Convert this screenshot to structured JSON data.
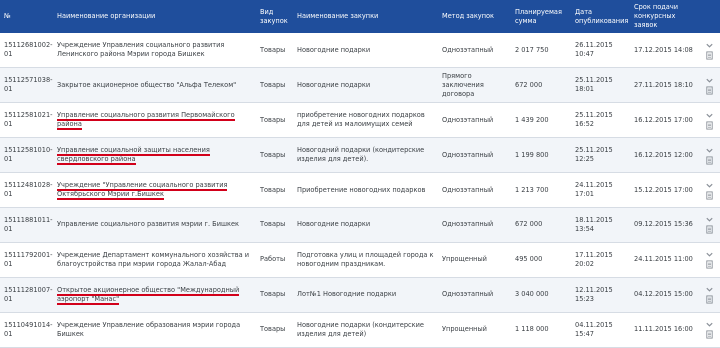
{
  "headers": {
    "num": "№",
    "org": "Наименование организации",
    "type": "Вид закупок",
    "name": "Наименование закупки",
    "method": "Метод закупок",
    "sum": "Планируемая сумма",
    "pub": "Дата опубликования",
    "deadline": "Срок подачи конкурсных заявок"
  },
  "rows": [
    {
      "num": "15112681002-01",
      "org": "Учреждение Управления социального развития Ленинского района Мэрии города Бишкек",
      "type": "Товары",
      "name": "Новогодние подарки",
      "method": "Однозэтапный",
      "sum": "2 017 750",
      "pub": "26.11.2015 10:47",
      "deadline": "17.12.2015 14:08",
      "hl": false
    },
    {
      "num": "15112571038-01",
      "org": "Закрытое акционерное общество \"Альфа Телеком\"",
      "type": "Товары",
      "name": "Новогодние подарки",
      "method": "Прямого заключения договора",
      "sum": "672 000",
      "pub": "25.11.2015 18:01",
      "deadline": "27.11.2015 18:10",
      "hl": false
    },
    {
      "num": "15112581021-01",
      "org": "Управление социального развития Первомайского района",
      "type": "Товары",
      "name": "приобретение новогодних подарков для детей из малоимущих семей",
      "method": "Однозэтапный",
      "sum": "1 439 200",
      "pub": "25.11.2015 16:52",
      "deadline": "16.12.2015 17:00",
      "hl": true
    },
    {
      "num": "15112581010-01",
      "org": "Управление социальной защиты населения свердловского района",
      "type": "Товары",
      "name": "Новогодний подарки (кондитерские изделия для детей).",
      "method": "Однозэтапный",
      "sum": "1 199 800",
      "pub": "25.11.2015 12:25",
      "deadline": "16.12.2015 12:00",
      "hl": true
    },
    {
      "num": "15112481028-01",
      "org": "Учреждение \"Управление социального развития Октябрьского Мэрии г.Бишкек",
      "type": "Товары",
      "name": "Приобретение новогодних подарков",
      "method": "Однозэтапный",
      "sum": "1 213 700",
      "pub": "24.11.2015 17:01",
      "deadline": "15.12.2015 17:00",
      "hl": true
    },
    {
      "num": "15111881011-01",
      "org": "Управление социального развития мэрии г. Бишкек",
      "type": "Товары",
      "name": "Новогодние подарки",
      "method": "Однозэтапный",
      "sum": "672 000",
      "pub": "18.11.2015 13:54",
      "deadline": "09.12.2015 15:36",
      "hl": false
    },
    {
      "num": "15111792001-01",
      "org": "Учреждение Департамент коммунального хозяйства и благоустройства при мэрии города Жалал-Абад",
      "type": "Работы",
      "name": "Подготовка улиц и площадей города к новогодним праздникам.",
      "method": "Упрощенный",
      "sum": "495 000",
      "pub": "17.11.2015 20:02",
      "deadline": "24.11.2015 11:00",
      "hl": false
    },
    {
      "num": "15111281007-01",
      "org": "Открытое акционерное общество \"Международный аэропорт \"Манас\"",
      "type": "Товары",
      "name": "Лот№1 Новогодние подарки",
      "method": "Однозэтапный",
      "sum": "3 040 000",
      "pub": "12.11.2015 15:23",
      "deadline": "04.12.2015 15:00",
      "hl": true
    },
    {
      "num": "15110491014-01",
      "org": "Учреждение Управление образования мэрии города Бишкек",
      "type": "Товары",
      "name": "Новогодние подарки (кондитерские изделия для детей)",
      "method": "Упрощенный",
      "sum": "1 118 000",
      "pub": "04.11.2015 15:47",
      "deadline": "11.11.2015 16:00",
      "hl": false
    }
  ]
}
